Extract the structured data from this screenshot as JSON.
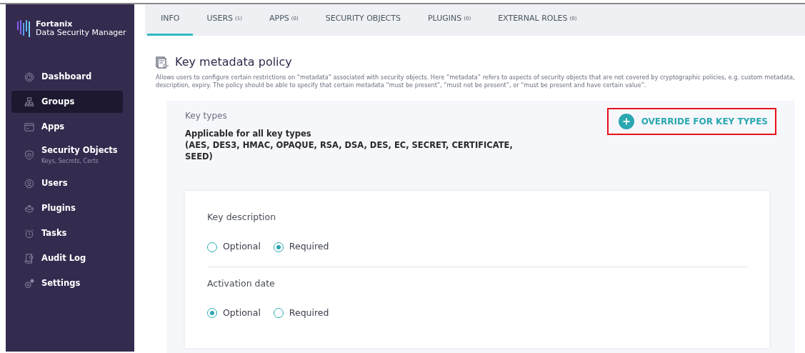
{
  "brand": {
    "name": "Fortanix",
    "product": "Data Security Manager"
  },
  "sidebar": {
    "items": [
      {
        "label": "Dashboard",
        "selected": false
      },
      {
        "label": "Groups",
        "selected": true
      },
      {
        "label": "Apps",
        "selected": false
      },
      {
        "label": "Security Objects",
        "sublabel": "Keys, Secrets, Certs",
        "selected": false
      },
      {
        "label": "Users",
        "selected": false
      },
      {
        "label": "Plugins",
        "selected": false
      },
      {
        "label": "Tasks",
        "selected": false
      },
      {
        "label": "Audit Log",
        "selected": false
      },
      {
        "label": "Settings",
        "selected": false
      }
    ]
  },
  "tabs": [
    {
      "label": "INFO",
      "selected": true
    },
    {
      "label": "USERS",
      "count": "(1)",
      "selected": false
    },
    {
      "label": "APPS",
      "count": "(0)",
      "selected": false
    },
    {
      "label": "SECURITY OBJECTS",
      "selected": false
    },
    {
      "label": "PLUGINS",
      "count": "(0)",
      "selected": false
    },
    {
      "label": "EXTERNAL ROLES",
      "count": "(0)",
      "selected": false
    }
  ],
  "policy": {
    "title": "Key metadata policy",
    "description": "Allows users to configure certain restrictions on “metadata” associated with security objects. Here “metadata” refers to aspects of security objects that are not covered by cryptographic policies, e.g. custom metadata, description, expiry. The policy should be able to specify that certain metadata “must be present”, “must not be present”, or “must be present and have certain value”.",
    "key_types_label": "Key types",
    "applicable": "Applicable for all key types",
    "types_list": "(AES, DES3, HMAC, OPAQUE, RSA, DSA, DES, EC, SECRET, CERTIFICATE, SEED)",
    "override_button": {
      "label": "OVERRIDE FOR KEY TYPES",
      "highlighted": true
    },
    "fields": [
      {
        "label": "Key description",
        "options": [
          {
            "label": "Optional",
            "selected": false
          },
          {
            "label": "Required",
            "selected": true
          }
        ]
      },
      {
        "label": "Activation date",
        "options": [
          {
            "label": "Optional",
            "selected": true
          },
          {
            "label": "Required",
            "selected": false
          }
        ]
      }
    ]
  }
}
